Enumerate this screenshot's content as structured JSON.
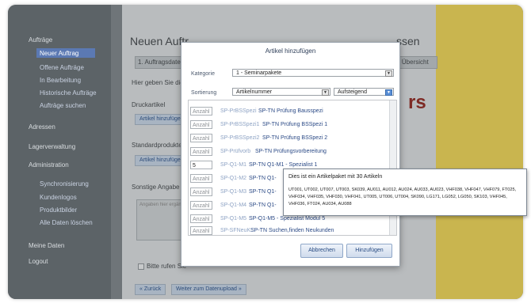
{
  "sidebar": {
    "items": [
      {
        "label": "Aufträge"
      },
      {
        "label": "Neuer Auftrag"
      },
      {
        "label": "Offene Aufträge"
      },
      {
        "label": "In Bearbeitung"
      },
      {
        "label": "Historische Aufträge"
      },
      {
        "label": "Aufträge suchen"
      },
      {
        "label": "Adressen"
      },
      {
        "label": "Lagerverwaltung"
      },
      {
        "label": "Administration"
      },
      {
        "label": "Synchronisierung"
      },
      {
        "label": "Kundenlogos"
      },
      {
        "label": "Produktbilder"
      },
      {
        "label": "Alle Daten löschen"
      },
      {
        "label": "Meine Daten"
      },
      {
        "label": "Logout"
      }
    ]
  },
  "main": {
    "title": "Neuen Auftr",
    "title_suffix": "ssen",
    "step1": "1. Auftragsdaten",
    "step_last": "5. Übersicht",
    "intro": "Hier geben Sie die",
    "druckartikel": "Druckartikel",
    "add_button_1": "Artikel hinzufügen",
    "standardprodukte": "Standardprodukte",
    "add_button_2": "Artikel hinzufügen",
    "sonstige": "Sonstige Angabe",
    "textarea_placeholder": "Angaben hier ergänzen",
    "checkbox_label": "Bitte rufen Sie",
    "back_button": "« Zurück",
    "next_button": "Weiter zum Datenupload »",
    "logo_text": "rs"
  },
  "modal": {
    "title": "Artikel hinzufügen",
    "kategorie_label": "Kategorie",
    "kategorie_value": "1 - Seminarpakete",
    "sortierung_label": "Sortierung",
    "sortierung_value": "Artikelnummer",
    "order_value": "Aufsteigend",
    "anzahl_placeholder": "Anzahl",
    "rows": [
      {
        "qty": "",
        "code": "SP-PrBSSpezi",
        "name": "SP-TN Prüfung Bausspezi"
      },
      {
        "qty": "",
        "code": "SP-PrBSSpezi1",
        "name": "SP-TN Prüfung BSSpezi 1"
      },
      {
        "qty": "",
        "code": "SP-PrBSSpezi2",
        "name": "SP-TN Prüfung BSSpezi 2"
      },
      {
        "qty": "",
        "code": "SP-Prüfvorb",
        "name": "SP-TN Prüfungsvorbereitung"
      },
      {
        "qty": "5",
        "code": "SP-Q1-M1",
        "name": "SP-TN Q1-M1 - Spezialist 1"
      },
      {
        "qty": "",
        "code": "SP-Q1-M2",
        "name": "SP-TN Q1-"
      },
      {
        "qty": "",
        "code": "SP-Q1-M3",
        "name": "SP-TN Q1-"
      },
      {
        "qty": "",
        "code": "SP-Q1-M4",
        "name": "SP-TN Q1-"
      },
      {
        "qty": "",
        "code": "SP-Q1-M5",
        "name": "SP-Q1-M5 - Spezialist Modul 5"
      },
      {
        "qty": "",
        "code": "SP-SFNeuK",
        "name": "SP-TN Suchen,finden Neukunden"
      }
    ],
    "cancel_button": "Abbrechen",
    "add_button": "Hinzufügen"
  },
  "tooltip": {
    "title": "Dies ist ein Artikelpaket mit 30 Artikeln",
    "body": "UT001, UT002, UT007, UT003, SK039, AU011, AU012, AU024, AU033, AU023, VHF038, VHF047, VHF079, FT025, VHF034, VHF035, VHF030, VHF041, UT005, UT006, UT004, SK090, LG171, LG052, LG050, SK103, VHF045, VHF036, FT024, AU034, AU088"
  }
}
